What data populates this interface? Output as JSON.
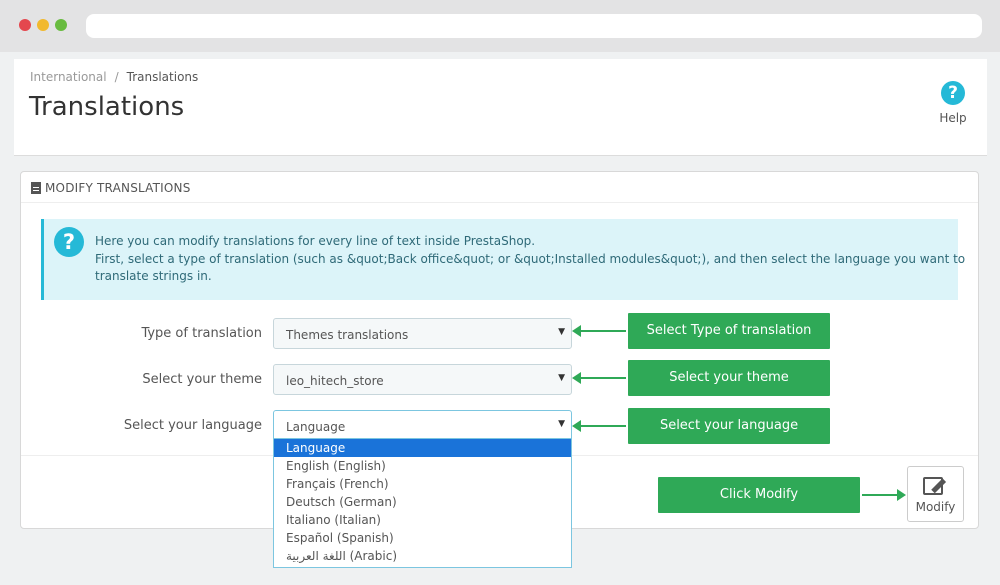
{
  "breadcrumb": {
    "parent": "International",
    "separator": "/",
    "current": "Translations"
  },
  "page_title": "Translations",
  "help": {
    "label": "Help",
    "icon": "question-circle-icon"
  },
  "panel": {
    "title": "MODIFY TRANSLATIONS",
    "icon": "document-icon",
    "alert": {
      "line1": "Here you can modify translations for every line of text inside PrestaShop.",
      "line2": "First, select a type of translation (such as &quot;Back office&quot; or &quot;Installed modules&quot;), and then select the language you want to",
      "line3": "translate strings in."
    },
    "form": {
      "type_label": "Type of translation",
      "type_value": "Themes translations",
      "theme_label": "Select your theme",
      "theme_value": "leo_hitech_store",
      "language_label": "Select your language",
      "language_value": "Language",
      "language_options": [
        "Language",
        "English (English)",
        "Français (French)",
        "Deutsch (German)",
        "Italiano (Italian)",
        "Español (Spanish)",
        "اللغة العربية (Arabic)"
      ]
    },
    "modify_button": "Modify"
  },
  "callouts": {
    "type": "Select Type of translation",
    "theme": "Select your theme",
    "language": "Select your language",
    "modify": "Click Modify"
  },
  "colors": {
    "accent": "#25b9d7",
    "callout": "#2fa957",
    "selected_option": "#1a73d9"
  }
}
